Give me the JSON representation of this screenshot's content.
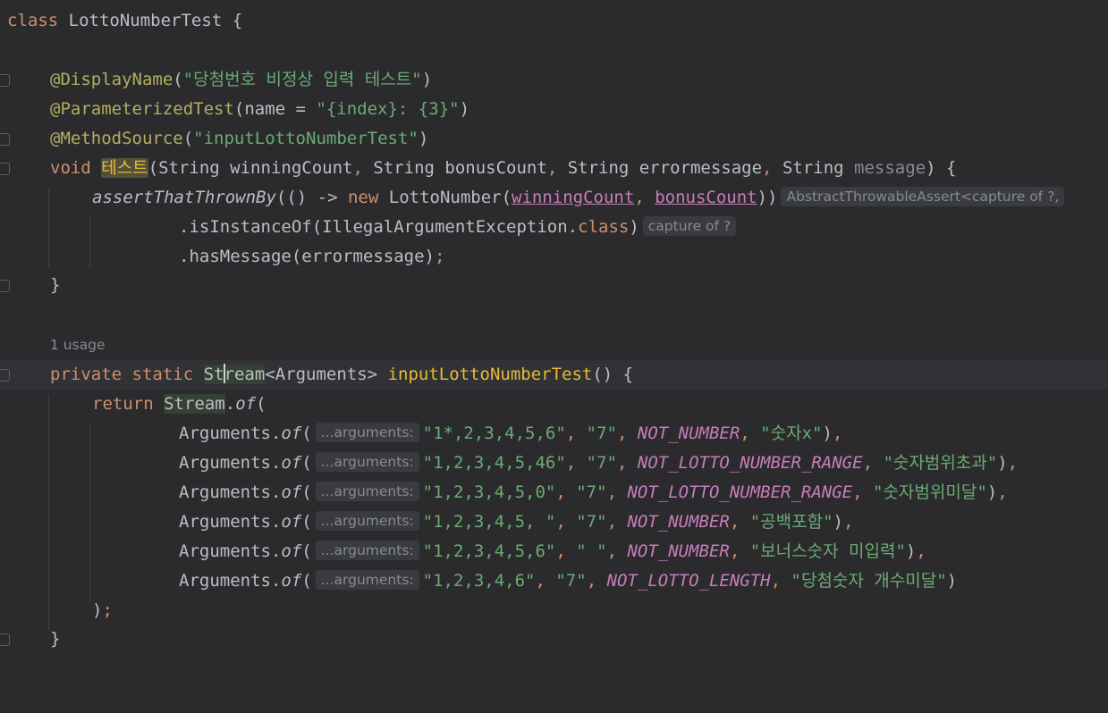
{
  "editor": {
    "lines": {
      "l1": {
        "kw": "class",
        "name": "LottoNumberTest",
        "brace": "{"
      },
      "l3": {
        "ann": "@DisplayName",
        "open": "(",
        "str": "\"당첨번호 비정상 입력 테스트\"",
        "close": ")"
      },
      "l4": {
        "ann": "@ParameterizedTest",
        "open": "(name = ",
        "str": "\"{index}: {3}\"",
        "close": ")"
      },
      "l5": {
        "ann": "@MethodSource",
        "open": "(",
        "str": "\"inputLottoNumberTest\"",
        "close": ")"
      },
      "l6": {
        "kw": "void",
        "name": "테스트",
        "p1": "(String winningCount",
        "comma1": ",",
        "p2": " String bonusCount",
        "comma2": ",",
        "p3": " String errormessage",
        "comma3": ",",
        "p4type": " String ",
        "p4name": "message",
        "end": ") {"
      },
      "l7": {
        "fn": "assertThatThrownBy",
        "mid": "(() -> ",
        "kw": "new",
        "cls": " LottoNumber(",
        "arg1": "winningCount",
        "comma": ", ",
        "arg2": "bonusCount",
        "close": "))",
        "hint": "AbstractThrowableAssert<capture of ?,"
      },
      "l8": {
        "text": ".isInstanceOf(IllegalArgumentException.",
        "kw": "class",
        "close": ")",
        "hint": "capture of ?"
      },
      "l9": {
        "text": ".hasMessage(errormessage)",
        "semi": ";"
      },
      "l10": {
        "brace": "}"
      },
      "usage": "1 usage",
      "l13": {
        "kw1": "private",
        "kw2": "static",
        "typeA": "St",
        "typeB": "ream",
        "generic": "<Arguments> ",
        "name": "inputLottoNumberTest",
        "end": "() {"
      },
      "l14": {
        "kw": "return",
        "type": "Stream",
        "dot": ".",
        "of": "of",
        "open": "("
      },
      "rows": [
        {
          "cls": "Arguments.",
          "of": "of",
          "open": "(",
          "hint": "...arguments:",
          "s1": "\"1*,2,3,4,5,6\"",
          "s2": "\"7\"",
          "c": "NOT_NUMBER",
          "s3": "\"숫자x\"",
          "end": "),"
        },
        {
          "cls": "Arguments.",
          "of": "of",
          "open": "(",
          "hint": "...arguments:",
          "s1": "\"1,2,3,4,5,46\"",
          "s2": "\"7\"",
          "c": "NOT_LOTTO_NUMBER_RANGE",
          "s3": "\"숫자범위초과\"",
          "end": "),"
        },
        {
          "cls": "Arguments.",
          "of": "of",
          "open": "(",
          "hint": "...arguments:",
          "s1": "\"1,2,3,4,5,0\"",
          "s2": "\"7\"",
          "c": "NOT_LOTTO_NUMBER_RANGE",
          "s3": "\"숫자범위미달\"",
          "end": "),"
        },
        {
          "cls": "Arguments.",
          "of": "of",
          "open": "(",
          "hint": "...arguments:",
          "s1": "\"1,2,3,4,5, \"",
          "s2": "\"7\"",
          "c": "NOT_NUMBER",
          "s3": "\"공백포함\"",
          "end": "),"
        },
        {
          "cls": "Arguments.",
          "of": "of",
          "open": "(",
          "hint": "...arguments:",
          "s1": "\"1,2,3,4,5,6\"",
          "s2": "\" \"",
          "c": "NOT_NUMBER",
          "s3": "\"보너스숫자 미입력\"",
          "end": "),"
        },
        {
          "cls": "Arguments.",
          "of": "of",
          "open": "(",
          "hint": "...arguments:",
          "s1": "\"1,2,3,4,6\"",
          "s2": "\"7\"",
          "c": "NOT_LOTTO_LENGTH",
          "s3": "\"당첨숫자 개수미달\"",
          "end": ")"
        }
      ],
      "l21": {
        "paren": ")",
        "semi": ";"
      },
      "l22": {
        "brace": "}"
      }
    }
  }
}
